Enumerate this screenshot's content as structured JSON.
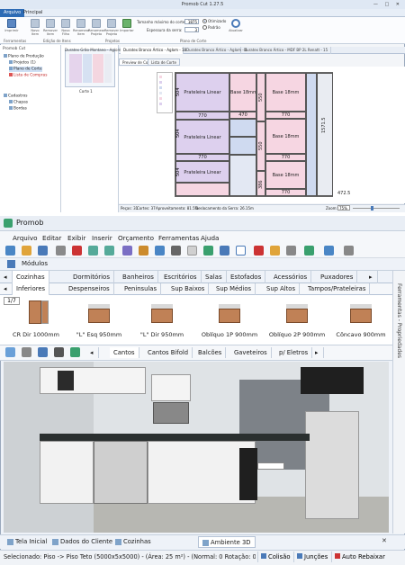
{
  "top_app": {
    "title": "Promob Cut 1.27.5",
    "window_controls": "— □ ✕",
    "menu_tabs": [
      "Arquivo",
      "Principal"
    ],
    "ribbon_buttons": [
      "Imprimir",
      "Novo Item",
      "Remover Item",
      "Novo Filho",
      "Renomear Item",
      "Renomear Projeto",
      "Remover Projeto",
      "Importar"
    ],
    "fields": {
      "max_size_label": "Tamanho máximo do corte:",
      "max_size_value": "1875",
      "saw_thickness_label": "Espessura da serra:",
      "saw_thickness_value": "3"
    },
    "radios": [
      "Otimizado",
      "Padrão"
    ],
    "update_button": "Atualizar",
    "groups": [
      "Ferramentas",
      "Edição de Itens",
      "Projetos",
      "Plano de Corte"
    ],
    "left_panel": {
      "title": "Promob Cut",
      "tree": [
        "Plano de Produção",
        "Projetos (1)",
        "Plano de Corte",
        "Lista de Compras",
        "Cadastros",
        "Chapas",
        "Bordas"
      ]
    },
    "thumb_caption": "Corte 1",
    "doc_tabs": [
      "Duratex Grão Montano - Aglom - 18",
      "Duratex Branco Ártico - Aglom - 18",
      "Duratex Branco Ártico - Aglom - 6",
      "Duratex Branco Ártico - MDF BP 2L Renatt - 15"
    ],
    "sub_tabs": [
      "Preview de Corte",
      "Lista de Corte"
    ],
    "sheet": {
      "pieces": {
        "prateleira": "Prateleira Linear",
        "base": "Base 18mm",
        "w770": "770",
        "w470": "470",
        "h504": "504",
        "h550": "550",
        "h386": "386",
        "w472": "472.5",
        "total": "1571.5"
      }
    },
    "status": {
      "pecas": "Peças: 31",
      "cortes": "Cortes: 37",
      "aproveitamento": "Aproveitamento: 81.5%",
      "deslocamento": "Deslocamento da Serra: 26.15m",
      "zoom_label": "Zoom:",
      "zoom_value": "75%"
    }
  },
  "promob": {
    "title": "Promob",
    "menu": [
      "Arquivo",
      "Editar",
      "Exibir",
      "Inserir",
      "Orçamento",
      "Ferramentas",
      "Ajuda"
    ],
    "modules_label": "Módulos",
    "category_tabs": [
      "Cozinhas",
      "Dormitórios",
      "Banheiros",
      "Escritórios",
      "Salas",
      "Estofados",
      "Acessórios",
      "Puxadores"
    ],
    "sub_tabs": [
      "Inferiores",
      "Despenseiros",
      "Peninsulas",
      "Sup Baixos",
      "Sup Médios",
      "Sup Altos",
      "Tampos/Prateleiras"
    ],
    "page_indicator": "1/7",
    "items": [
      "CR Dir 1000mm",
      "\"L\" Esq 950mm",
      "\"L\" Dir 950mm",
      "Oblíquo 1P 900mm",
      "Oblíquo 2P 900mm",
      "Côncavo 900mm"
    ],
    "corner_tabs": [
      "Cantos",
      "Cantos Bifold",
      "Balcões",
      "Gaveteiros",
      "p/ Eletros"
    ],
    "side_panel": "Ferramentas - Propriedades",
    "bottom_tabs": [
      "Tela Inicial",
      "Dados do Cliente",
      "Cozinhas",
      "Ambiente 3D"
    ],
    "status": {
      "text": "Selecionado: Piso -> Piso Teto (5000x5x5000) - (Área: 25 m²) - (Normal: 0 Rotação: 0)",
      "colisao": "Colisão",
      "juncoes": "Junções",
      "auto_rebaixar": "Auto Rebaixar"
    }
  },
  "colors": {
    "accent": "#2d6bb5",
    "cabinet_wood": "#c08156",
    "sheet_pink": "#f6d6e2",
    "sheet_purple": "#ddd0ee",
    "sheet_blue": "#cfdaf0"
  }
}
